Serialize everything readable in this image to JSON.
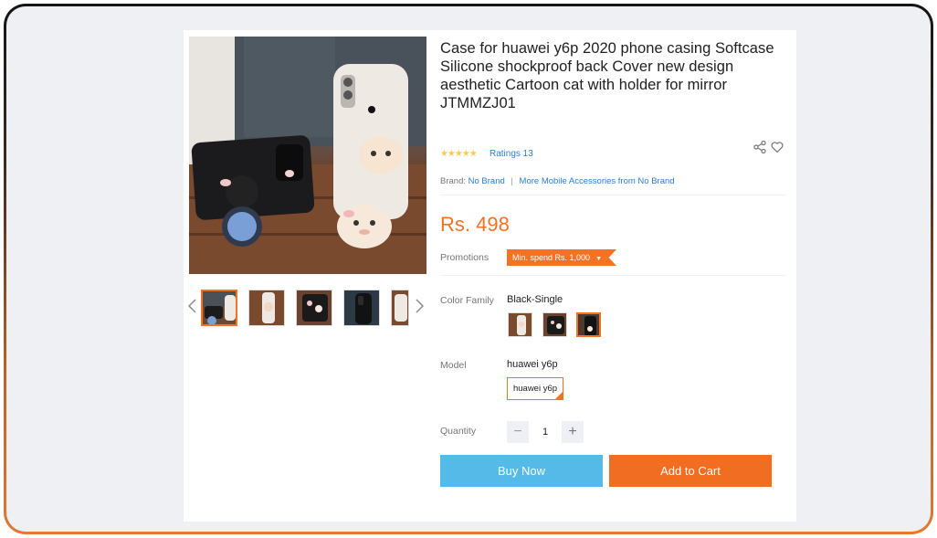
{
  "product": {
    "title": "Case for huawei y6p 2020 phone casing Softcase Silicone shockproof back Cover new design aesthetic Cartoon cat with holder for mirror JTMMZJ01",
    "stars": "★★★★★",
    "ratings_label": "Ratings 13",
    "brand_prefix": "Brand:",
    "brand_name": "No Brand",
    "brand_more": "More Mobile Accessories from No Brand",
    "price": "Rs. 498"
  },
  "promotions": {
    "label": "Promotions",
    "tag": "Min. spend Rs. 1,000"
  },
  "color_family": {
    "label": "Color Family",
    "selected": "Black-Single"
  },
  "model": {
    "label": "Model",
    "selected": "huawei y6p",
    "option": "huawei y6p"
  },
  "quantity": {
    "label": "Quantity",
    "value": "1",
    "minus": "−",
    "plus": "+"
  },
  "actions": {
    "buy_now": "Buy Now",
    "add_to_cart": "Add to Cart"
  },
  "icons": {
    "share": "share-icon",
    "wishlist": "heart-icon",
    "prev": "chevron-left-icon",
    "next": "chevron-right-icon"
  },
  "colors": {
    "accent": "#f57224",
    "link": "#2a7fd1",
    "buy": "#56bae8",
    "cart": "#f06d22"
  }
}
